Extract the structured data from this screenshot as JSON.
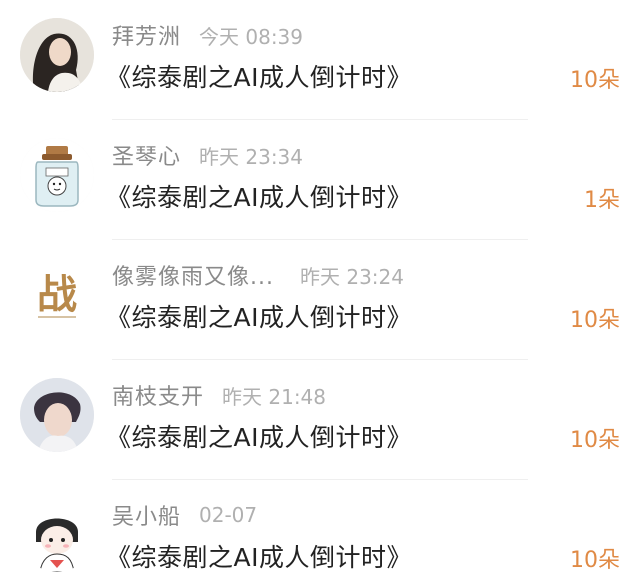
{
  "records": [
    {
      "user": "拜芳洲",
      "time": "今天 08:39",
      "title": "《综泰剧之AI成人倒计时》",
      "count": "10朵",
      "avatar_icon": "woman-portrait-avatar"
    },
    {
      "user": "圣琴心",
      "time": "昨天 23:34",
      "title": "《综泰剧之AI成人倒计时》",
      "count": "1朵",
      "avatar_icon": "jar-cartoon-avatar"
    },
    {
      "user": "像雾像雨又像...",
      "time": "昨天 23:24",
      "title": "《综泰剧之AI成人倒计时》",
      "count": "10朵",
      "avatar_icon": "calligraphy-avatar"
    },
    {
      "user": "南枝支开",
      "time": "昨天 21:48",
      "title": "《综泰剧之AI成人倒计时》",
      "count": "10朵",
      "avatar_icon": "man-portrait-avatar"
    },
    {
      "user": "吴小船",
      "time": "02-07",
      "title": "《综泰剧之AI成人倒计时》",
      "count": "10朵",
      "avatar_icon": "cartoon-girl-avatar"
    }
  ],
  "avatar_calligraphy_text": "战",
  "colors": {
    "count": "#e08a45",
    "name": "#8a8a8a",
    "time": "#b0b0b0",
    "title": "#222222"
  }
}
